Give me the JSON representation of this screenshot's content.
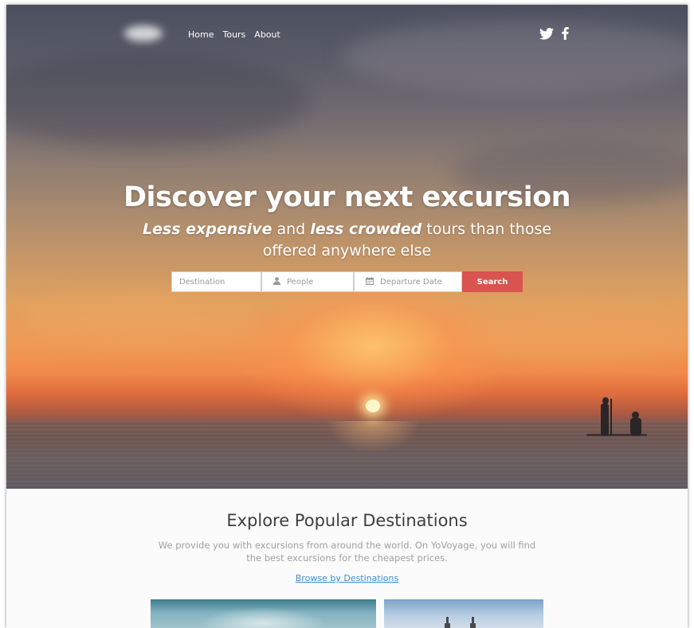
{
  "nav": {
    "items": [
      "Home",
      "Tours",
      "About"
    ],
    "social": [
      {
        "icon": "twitter-icon"
      },
      {
        "icon": "facebook-icon"
      }
    ]
  },
  "hero": {
    "title": "Discover your next excursion",
    "subtitle": {
      "part1": "Less expensive",
      "part2": " and ",
      "part3": "less crowded",
      "part4": " tours than those offered anywhere else"
    }
  },
  "search": {
    "destination_placeholder": "Destination",
    "people_placeholder": "People",
    "date_placeholder": "Departure Date",
    "button_label": "Search",
    "button_color": "#d9534f"
  },
  "explore": {
    "title": "Explore Popular Destinations",
    "description": "We provide you with excursions from around the world. On YoVoyage, you will find the best excursions for the cheapest prices.",
    "link_label": "Browse by Destinations",
    "link_color": "#3a8fd6"
  }
}
